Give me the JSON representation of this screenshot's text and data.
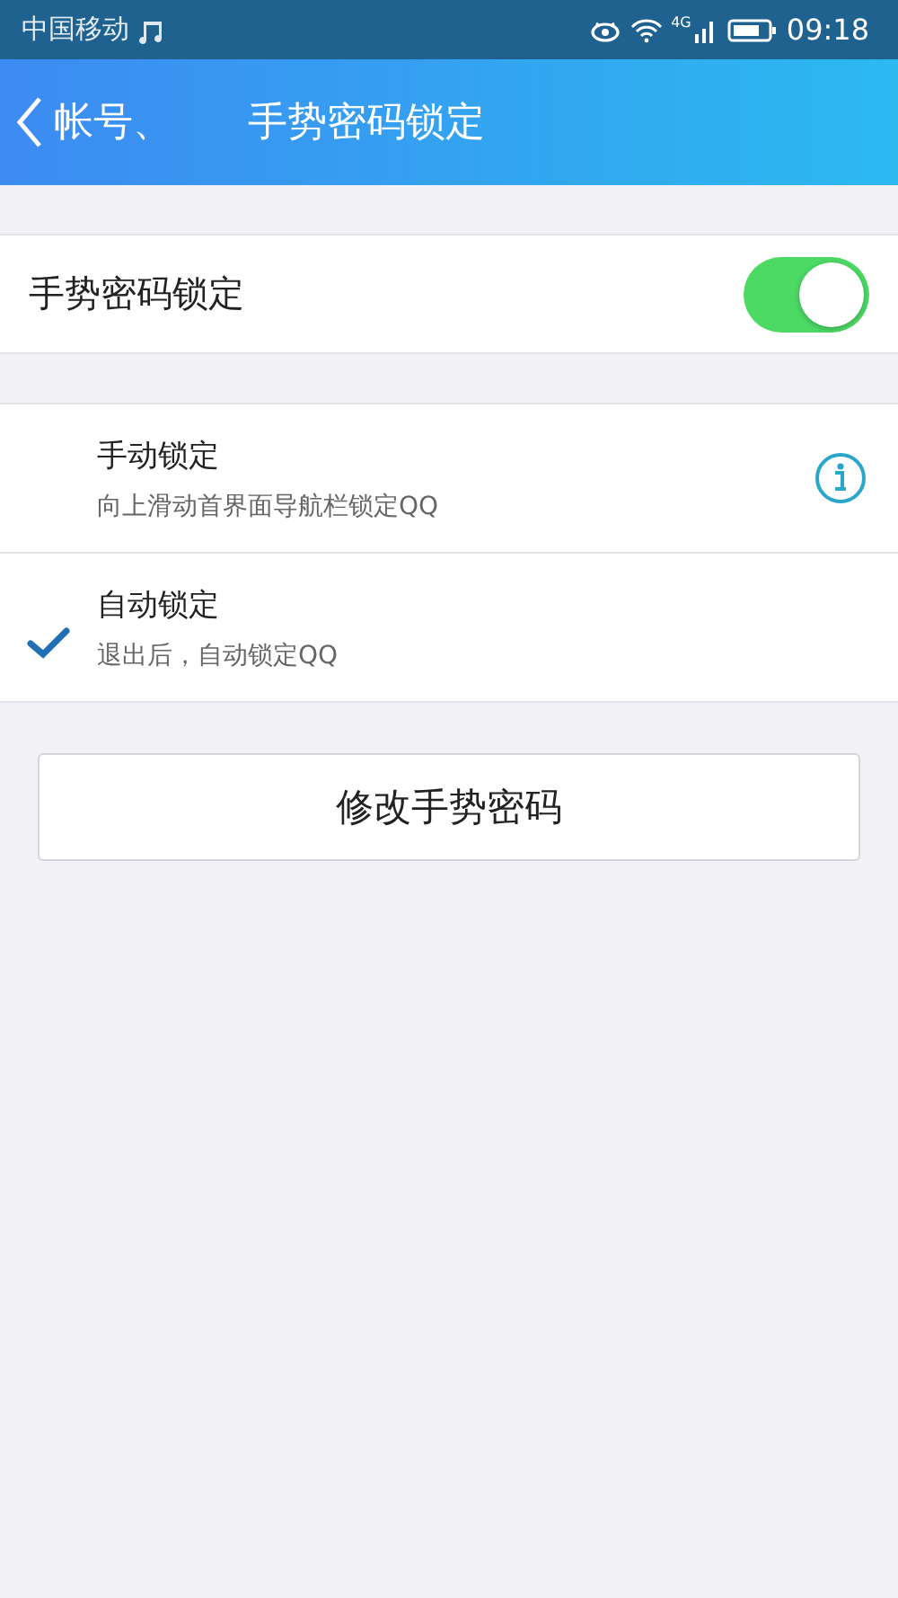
{
  "status_bar": {
    "carrier": "中国移动",
    "network": "4G",
    "time": "09:18"
  },
  "header": {
    "back_label": "帐号、",
    "title": "手势密码锁定"
  },
  "toggle": {
    "label": "手势密码锁定",
    "on": true
  },
  "options": [
    {
      "title": "手动锁定",
      "subtitle": "向上滑动首界面导航栏锁定QQ",
      "selected": false,
      "info_button": true
    },
    {
      "title": "自动锁定",
      "subtitle": "退出后，自动锁定QQ",
      "selected": true,
      "info_button": false
    }
  ],
  "action_button": "修改手势密码"
}
